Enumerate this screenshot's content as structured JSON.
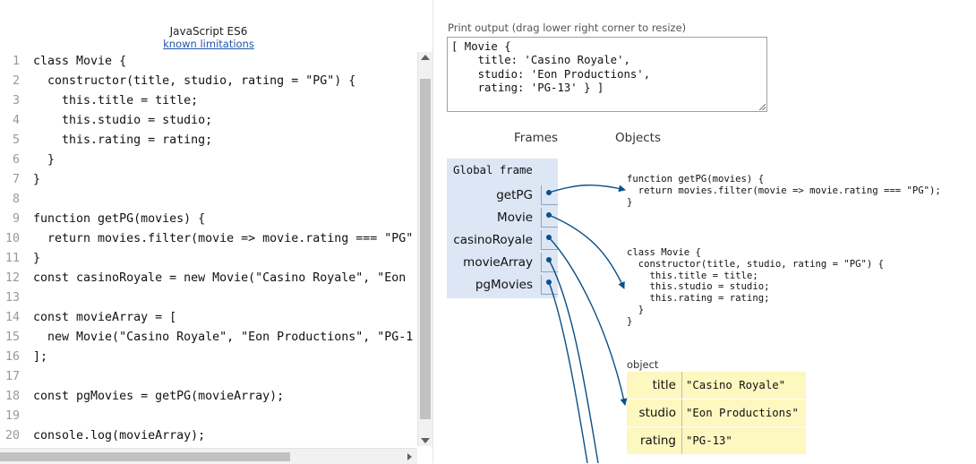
{
  "editor": {
    "title": "JavaScript ES6",
    "limitations_link": "known limitations",
    "lines": [
      {
        "num": "1",
        "code": "class Movie {"
      },
      {
        "num": "2",
        "code": "  constructor(title, studio, rating = \"PG\") {"
      },
      {
        "num": "3",
        "code": "    this.title = title;"
      },
      {
        "num": "4",
        "code": "    this.studio = studio;"
      },
      {
        "num": "5",
        "code": "    this.rating = rating;"
      },
      {
        "num": "6",
        "code": "  }"
      },
      {
        "num": "7",
        "code": "}"
      },
      {
        "num": "8",
        "code": ""
      },
      {
        "num": "9",
        "code": "function getPG(movies) {"
      },
      {
        "num": "10",
        "code": "  return movies.filter(movie => movie.rating === \"PG\""
      },
      {
        "num": "11",
        "code": "}"
      },
      {
        "num": "12",
        "code": "const casinoRoyale = new Movie(\"Casino Royale\", \"Eon"
      },
      {
        "num": "13",
        "code": ""
      },
      {
        "num": "14",
        "code": "const movieArray = ["
      },
      {
        "num": "15",
        "code": "  new Movie(\"Casino Royale\", \"Eon Productions\", \"PG-1"
      },
      {
        "num": "16",
        "code": "];"
      },
      {
        "num": "17",
        "code": ""
      },
      {
        "num": "18",
        "code": "const pgMovies = getPG(movieArray);"
      },
      {
        "num": "19",
        "code": ""
      },
      {
        "num": "20",
        "code": "console.log(movieArray);"
      }
    ]
  },
  "print_output": {
    "label": "Print output (drag lower right corner to resize)",
    "text": "[ Movie {\n    title: 'Casino Royale',\n    studio: 'Eon Productions',\n    rating: 'PG-13' } ]"
  },
  "visualizer": {
    "frames_header": "Frames",
    "objects_header": "Objects",
    "global_frame_label": "Global frame",
    "variables": [
      {
        "name": "getPG"
      },
      {
        "name": "Movie"
      },
      {
        "name": "casinoRoyale"
      },
      {
        "name": "movieArray"
      },
      {
        "name": "pgMovies"
      }
    ],
    "function_getpg_code": "function getPG(movies) {\n  return movies.filter(movie => movie.rating === \"PG\");\n}",
    "class_movie_code": "class Movie {\n  constructor(title, studio, rating = \"PG\") {\n    this.title = title;\n    this.studio = studio;\n    this.rating = rating;\n  }\n}",
    "object_label": "object",
    "object_props": [
      {
        "key": "title",
        "value": "\"Casino Royale\""
      },
      {
        "key": "studio",
        "value": "\"Eon Productions\""
      },
      {
        "key": "rating",
        "value": "\"PG-13\""
      }
    ],
    "arrow_color": "#0a4f89",
    "frame_color": "#dce6f4",
    "object_color": "#fdf7c0"
  }
}
